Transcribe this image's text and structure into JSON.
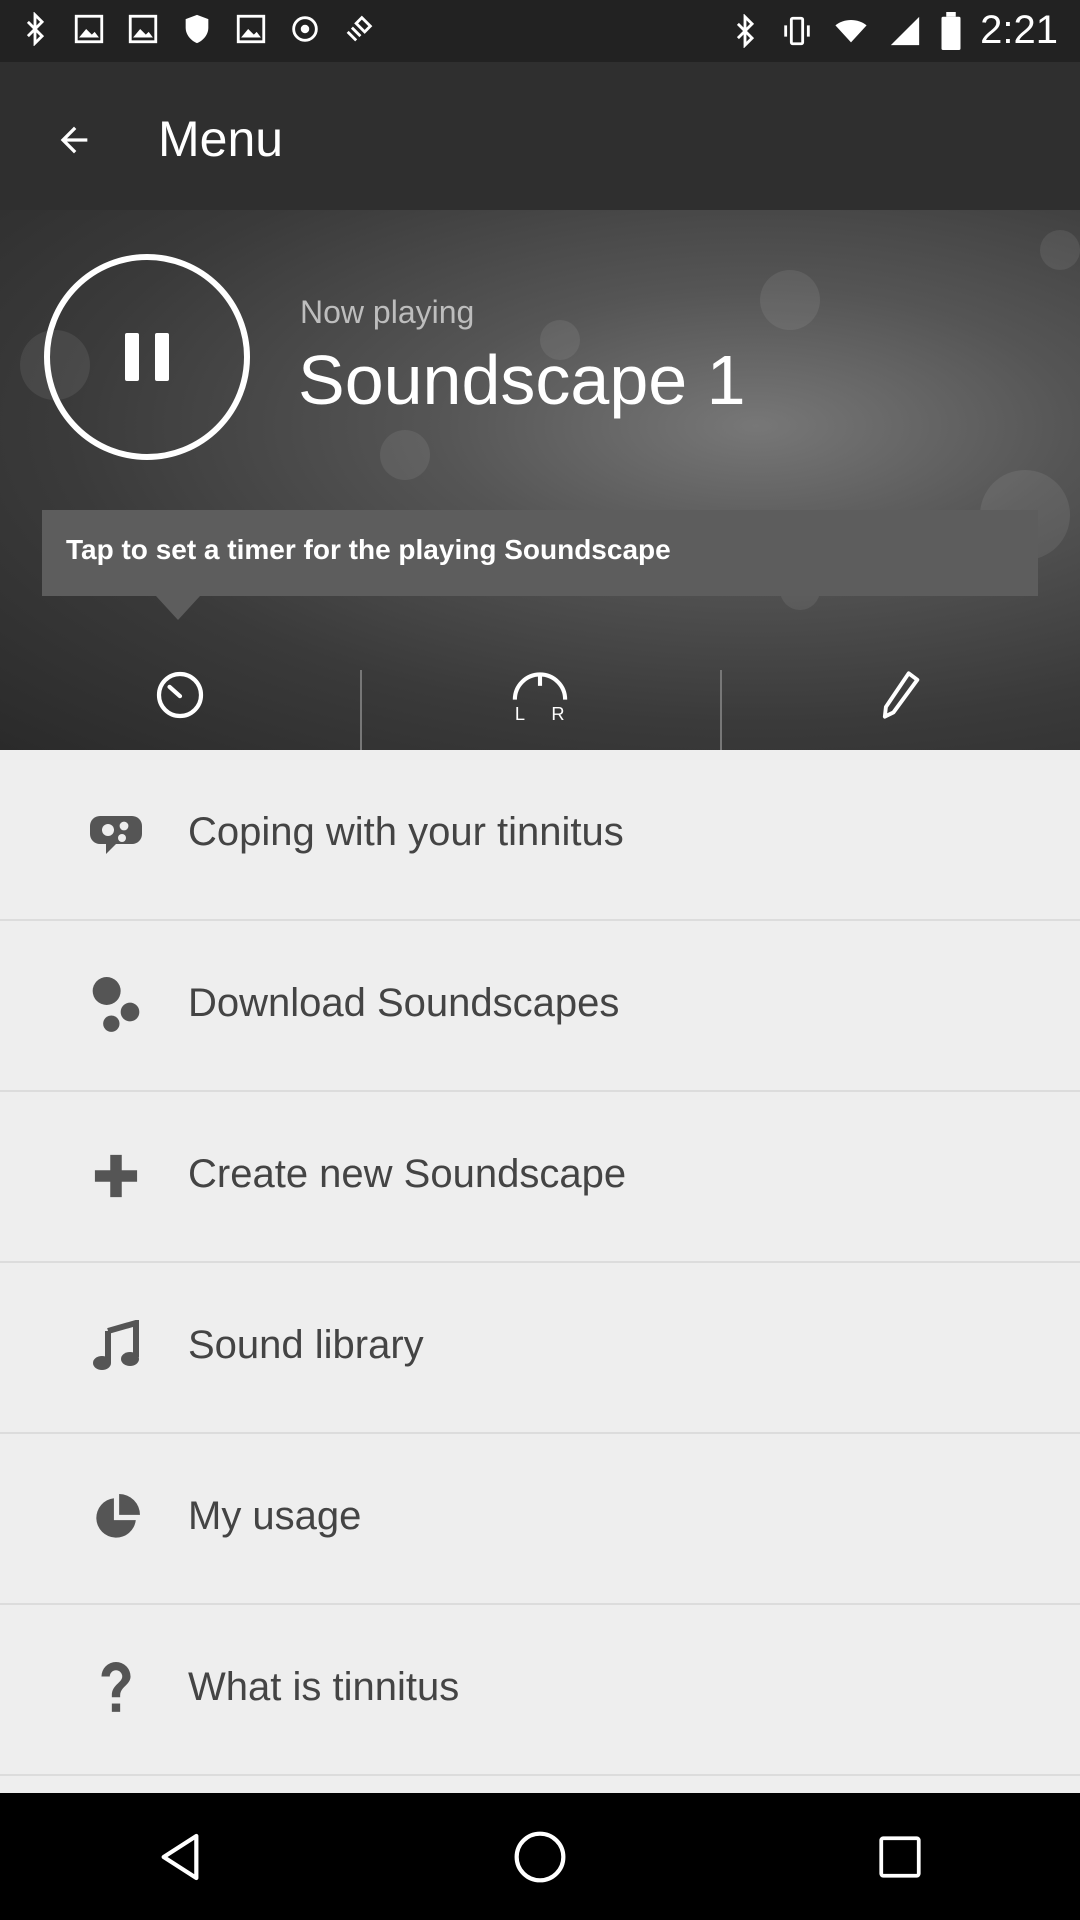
{
  "status_bar": {
    "time": "2:21",
    "left_icons": [
      "bluetooth-icon",
      "photo-icon",
      "photo-icon",
      "shield-icon",
      "photo-icon",
      "circle-icon",
      "satellite-icon"
    ],
    "right_icons": [
      "bluetooth-icon",
      "vibrate-icon",
      "wifi-icon",
      "signal-icon",
      "battery-icon"
    ]
  },
  "app_bar": {
    "title": "Menu",
    "back_icon": "arrow-back-icon"
  },
  "now_playing": {
    "label": "Now playing",
    "title": "Soundscape 1",
    "control": "pause-icon"
  },
  "tooltip": {
    "text": "Tap to set a timer for the playing Soundscape"
  },
  "actions": [
    {
      "name": "timer",
      "icon": "timer-icon"
    },
    {
      "name": "balance",
      "icon": "left-right-balance-icon"
    },
    {
      "name": "edit",
      "icon": "pencil-icon"
    }
  ],
  "menu": {
    "items": [
      {
        "label": "Coping with your tinnitus",
        "icon": "brain-gears-icon"
      },
      {
        "label": "Download Soundscapes",
        "icon": "bubbles-icon"
      },
      {
        "label": "Create new Soundscape",
        "icon": "plus-icon"
      },
      {
        "label": "Sound library",
        "icon": "music-note-icon"
      },
      {
        "label": "My usage",
        "icon": "pie-chart-icon"
      },
      {
        "label": "What is tinnitus",
        "icon": "question-icon"
      }
    ]
  },
  "nav_bar": {
    "buttons": [
      "back-icon",
      "home-icon",
      "recents-icon"
    ]
  },
  "colors": {
    "app_bar": "#2f2f2f",
    "menu_bg": "#eeeeee",
    "menu_text": "#444444",
    "tooltip_bg": "#5d5d5d"
  }
}
